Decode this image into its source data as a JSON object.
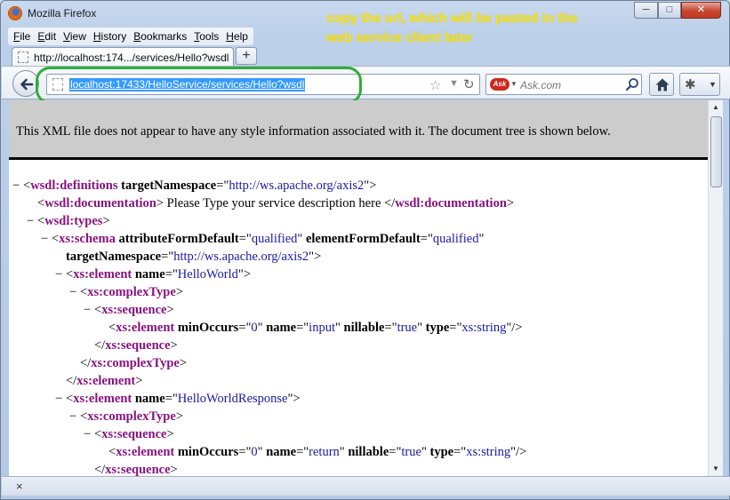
{
  "window": {
    "title": "Mozilla Firefox",
    "min_glyph": "─",
    "max_glyph": "□",
    "close_glyph": "✕"
  },
  "annotation": {
    "text": "copy the url, which will be pasted in the web service client later",
    "color": "#f5e21c",
    "ring_color": "#2fae3a"
  },
  "menu": [
    {
      "acc": "F",
      "rest": "ile"
    },
    {
      "acc": "E",
      "rest": "dit"
    },
    {
      "acc": "V",
      "rest": "iew"
    },
    {
      "acc": "H",
      "rest": "istory"
    },
    {
      "acc": "B",
      "rest": "ookmarks"
    },
    {
      "acc": "T",
      "rest": "ools"
    },
    {
      "acc": "H",
      "rest": "elp"
    }
  ],
  "tab": {
    "label": "http://localhost:174.../services/Hello?wsdl",
    "new_tab_glyph": "+"
  },
  "navbar": {
    "url": "localhost:17433/HelloService/services/Hello?wsdl",
    "search_placeholder": "Ask.com",
    "ask_logo": "Ask"
  },
  "page": {
    "info_text": "This XML file does not appear to have any style information associated with it. The document tree is shown below."
  },
  "xml_lines": [
    {
      "indent": 0,
      "toggle": "−",
      "parts": [
        {
          "k": "txt",
          "t": "<"
        },
        {
          "k": "tag",
          "t": "wsdl:definitions"
        },
        {
          "k": "txt",
          "t": " "
        },
        {
          "k": "attr",
          "t": "targetNamespace"
        },
        {
          "k": "txt",
          "t": "=\""
        },
        {
          "k": "val",
          "t": "http://ws.apache.org/axis2"
        },
        {
          "k": "txt",
          "t": "\">"
        }
      ]
    },
    {
      "indent": 1,
      "toggle": "",
      "parts": [
        {
          "k": "txt",
          "t": "<"
        },
        {
          "k": "tag",
          "t": "wsdl:documentation"
        },
        {
          "k": "txt",
          "t": "> Please Type your service description here </"
        },
        {
          "k": "tag",
          "t": "wsdl:documentation"
        },
        {
          "k": "txt",
          "t": ">"
        }
      ]
    },
    {
      "indent": 1,
      "toggle": "−",
      "parts": [
        {
          "k": "txt",
          "t": "<"
        },
        {
          "k": "tag",
          "t": "wsdl:types"
        },
        {
          "k": "txt",
          "t": ">"
        }
      ]
    },
    {
      "indent": 2,
      "toggle": "−",
      "parts": [
        {
          "k": "txt",
          "t": "<"
        },
        {
          "k": "tag",
          "t": "xs:schema"
        },
        {
          "k": "txt",
          "t": " "
        },
        {
          "k": "attr",
          "t": "attributeFormDefault"
        },
        {
          "k": "txt",
          "t": "=\""
        },
        {
          "k": "val",
          "t": "qualified"
        },
        {
          "k": "txt",
          "t": "\" "
        },
        {
          "k": "attr",
          "t": "elementFormDefault"
        },
        {
          "k": "txt",
          "t": "=\""
        },
        {
          "k": "val",
          "t": "qualified"
        },
        {
          "k": "txt",
          "t": "\""
        }
      ]
    },
    {
      "indent": 3,
      "toggle": "",
      "parts": [
        {
          "k": "attr",
          "t": "targetNamespace"
        },
        {
          "k": "txt",
          "t": "=\""
        },
        {
          "k": "val",
          "t": "http://ws.apache.org/axis2"
        },
        {
          "k": "txt",
          "t": "\">"
        }
      ]
    },
    {
      "indent": 3,
      "toggle": "−",
      "parts": [
        {
          "k": "txt",
          "t": "<"
        },
        {
          "k": "tag",
          "t": "xs:element"
        },
        {
          "k": "txt",
          "t": " "
        },
        {
          "k": "attr",
          "t": "name"
        },
        {
          "k": "txt",
          "t": "=\""
        },
        {
          "k": "val",
          "t": "HelloWorld"
        },
        {
          "k": "txt",
          "t": "\">"
        }
      ]
    },
    {
      "indent": 4,
      "toggle": "−",
      "parts": [
        {
          "k": "txt",
          "t": "<"
        },
        {
          "k": "tag",
          "t": "xs:complexType"
        },
        {
          "k": "txt",
          "t": ">"
        }
      ]
    },
    {
      "indent": 5,
      "toggle": "−",
      "parts": [
        {
          "k": "txt",
          "t": "<"
        },
        {
          "k": "tag",
          "t": "xs:sequence"
        },
        {
          "k": "txt",
          "t": ">"
        }
      ]
    },
    {
      "indent": 6,
      "toggle": "",
      "parts": [
        {
          "k": "txt",
          "t": "<"
        },
        {
          "k": "tag",
          "t": "xs:element"
        },
        {
          "k": "txt",
          "t": " "
        },
        {
          "k": "attr",
          "t": "minOccurs"
        },
        {
          "k": "txt",
          "t": "=\""
        },
        {
          "k": "val",
          "t": "0"
        },
        {
          "k": "txt",
          "t": "\" "
        },
        {
          "k": "attr",
          "t": "name"
        },
        {
          "k": "txt",
          "t": "=\""
        },
        {
          "k": "val",
          "t": "input"
        },
        {
          "k": "txt",
          "t": "\" "
        },
        {
          "k": "attr",
          "t": "nillable"
        },
        {
          "k": "txt",
          "t": "=\""
        },
        {
          "k": "val",
          "t": "true"
        },
        {
          "k": "txt",
          "t": "\" "
        },
        {
          "k": "attr",
          "t": "type"
        },
        {
          "k": "txt",
          "t": "=\""
        },
        {
          "k": "val",
          "t": "xs:string"
        },
        {
          "k": "txt",
          "t": "\"/>"
        }
      ]
    },
    {
      "indent": 5,
      "toggle": "",
      "parts": [
        {
          "k": "txt",
          "t": "</"
        },
        {
          "k": "tag",
          "t": "xs:sequence"
        },
        {
          "k": "txt",
          "t": ">"
        }
      ]
    },
    {
      "indent": 4,
      "toggle": "",
      "parts": [
        {
          "k": "txt",
          "t": "</"
        },
        {
          "k": "tag",
          "t": "xs:complexType"
        },
        {
          "k": "txt",
          "t": ">"
        }
      ]
    },
    {
      "indent": 3,
      "toggle": "",
      "parts": [
        {
          "k": "txt",
          "t": "</"
        },
        {
          "k": "tag",
          "t": "xs:element"
        },
        {
          "k": "txt",
          "t": ">"
        }
      ]
    },
    {
      "indent": 3,
      "toggle": "−",
      "parts": [
        {
          "k": "txt",
          "t": "<"
        },
        {
          "k": "tag",
          "t": "xs:element"
        },
        {
          "k": "txt",
          "t": " "
        },
        {
          "k": "attr",
          "t": "name"
        },
        {
          "k": "txt",
          "t": "=\""
        },
        {
          "k": "val",
          "t": "HelloWorldResponse"
        },
        {
          "k": "txt",
          "t": "\">"
        }
      ]
    },
    {
      "indent": 4,
      "toggle": "−",
      "parts": [
        {
          "k": "txt",
          "t": "<"
        },
        {
          "k": "tag",
          "t": "xs:complexType"
        },
        {
          "k": "txt",
          "t": ">"
        }
      ]
    },
    {
      "indent": 5,
      "toggle": "−",
      "parts": [
        {
          "k": "txt",
          "t": "<"
        },
        {
          "k": "tag",
          "t": "xs:sequence"
        },
        {
          "k": "txt",
          "t": ">"
        }
      ]
    },
    {
      "indent": 6,
      "toggle": "",
      "parts": [
        {
          "k": "txt",
          "t": "<"
        },
        {
          "k": "tag",
          "t": "xs:element"
        },
        {
          "k": "txt",
          "t": " "
        },
        {
          "k": "attr",
          "t": "minOccurs"
        },
        {
          "k": "txt",
          "t": "=\""
        },
        {
          "k": "val",
          "t": "0"
        },
        {
          "k": "txt",
          "t": "\" "
        },
        {
          "k": "attr",
          "t": "name"
        },
        {
          "k": "txt",
          "t": "=\""
        },
        {
          "k": "val",
          "t": "return"
        },
        {
          "k": "txt",
          "t": "\" "
        },
        {
          "k": "attr",
          "t": "nillable"
        },
        {
          "k": "txt",
          "t": "=\""
        },
        {
          "k": "val",
          "t": "true"
        },
        {
          "k": "txt",
          "t": "\" "
        },
        {
          "k": "attr",
          "t": "type"
        },
        {
          "k": "txt",
          "t": "=\""
        },
        {
          "k": "val",
          "t": "xs:string"
        },
        {
          "k": "txt",
          "t": "\"/>"
        }
      ]
    },
    {
      "indent": 5,
      "toggle": "",
      "parts": [
        {
          "k": "txt",
          "t": "</"
        },
        {
          "k": "tag",
          "t": "xs:sequence"
        },
        {
          "k": "txt",
          "t": ">"
        }
      ]
    }
  ],
  "addon_bar": {
    "close_glyph": "×"
  },
  "icons": {
    "back": "back-arrow-icon",
    "home": "home-icon",
    "search": "magnifier-icon",
    "bookmark": "star-icon",
    "reload": "reload-icon"
  }
}
